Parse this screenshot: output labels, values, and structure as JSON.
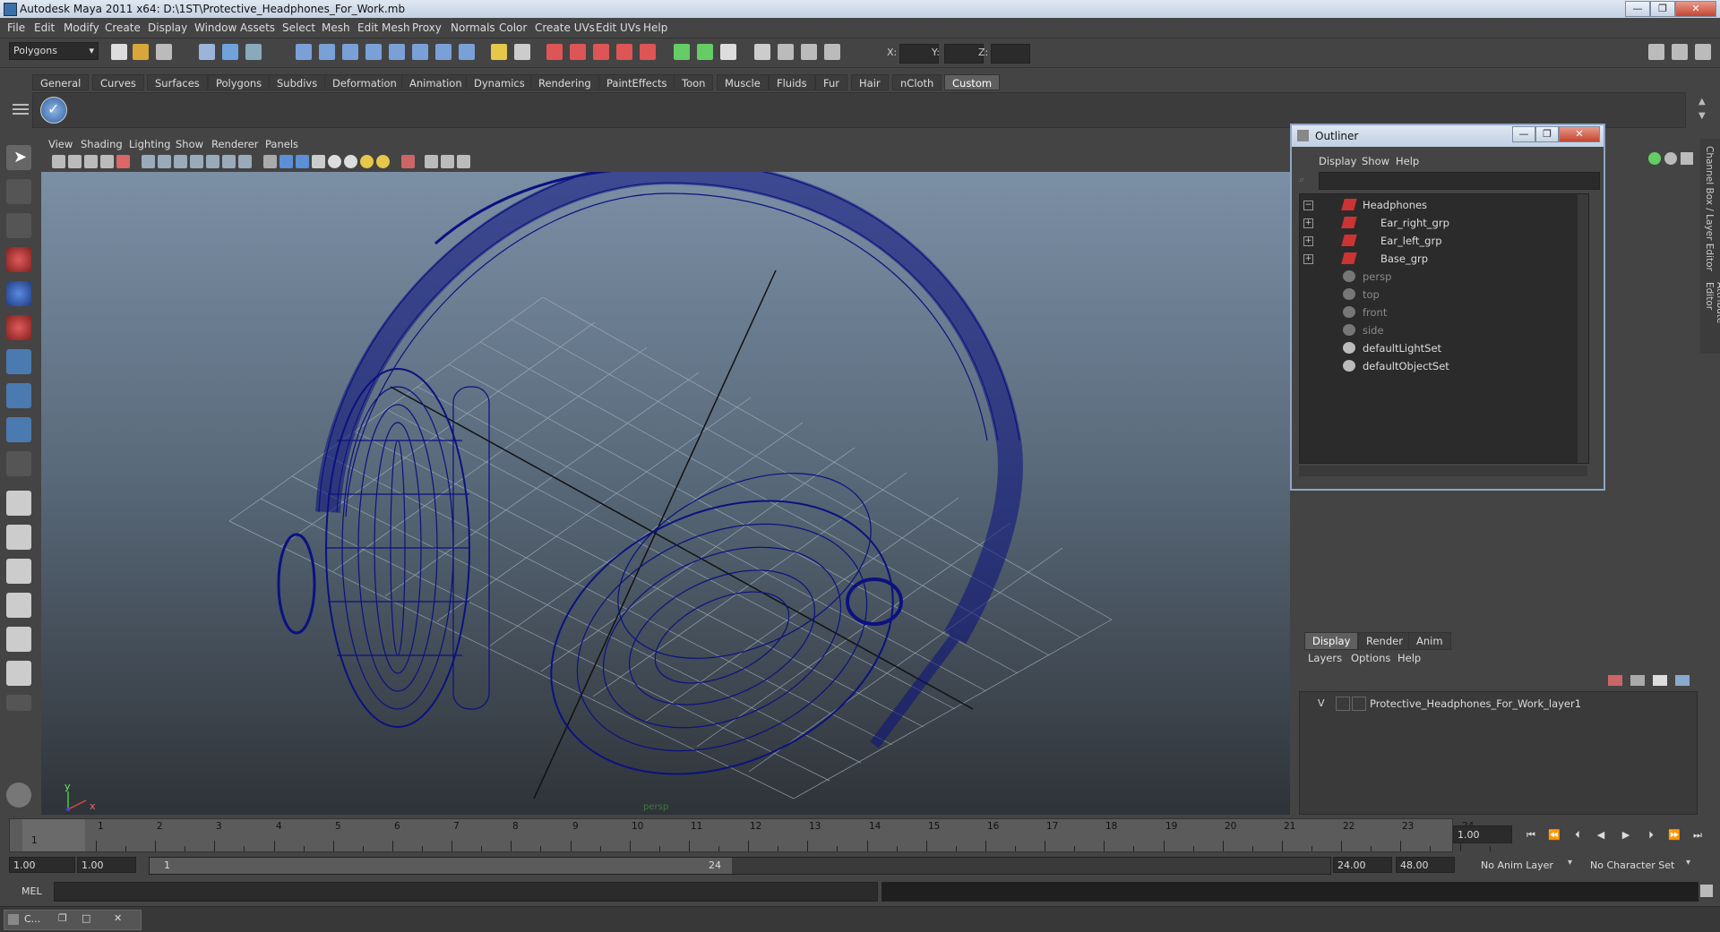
{
  "window": {
    "title": "Autodesk Maya 2011 x64: D:\\1ST\\Protective_Headphones_For_Work.mb",
    "minimize_glyph": "—",
    "maximize_glyph": "❐",
    "close_glyph": "✕"
  },
  "menubar": {
    "items": [
      "File",
      "Edit",
      "Modify",
      "Create",
      "Display",
      "Window",
      "Assets",
      "Select",
      "Mesh",
      "Edit Mesh",
      "Proxy",
      "Normals",
      "Color",
      "Create UVs",
      "Edit UVs",
      "Help"
    ]
  },
  "statusline": {
    "mode_selector": "Polygons",
    "x_label": "X:",
    "y_label": "Y:",
    "z_label": "Z:"
  },
  "shelf": {
    "tabs": [
      "General",
      "Curves",
      "Surfaces",
      "Polygons",
      "Subdivs",
      "Deformation",
      "Animation",
      "Dynamics",
      "Rendering",
      "PaintEffects",
      "Toon",
      "Muscle",
      "Fluids",
      "Fur",
      "Hair",
      "nCloth",
      "Custom"
    ],
    "active_tab": "Custom"
  },
  "viewport": {
    "menu": [
      "View",
      "Shading",
      "Lighting",
      "Show",
      "Renderer",
      "Panels"
    ],
    "axis_x": "x",
    "axis_y": "y",
    "camera_label": "persp"
  },
  "outliner": {
    "title": "Outliner",
    "menu": [
      "Display",
      "Show",
      "Help"
    ],
    "items": [
      {
        "label": "Headphones",
        "expand": "−",
        "dim": false
      },
      {
        "label": "Ear_right_grp",
        "expand": "+",
        "dim": false
      },
      {
        "label": "Ear_left_grp",
        "expand": "+",
        "dim": false
      },
      {
        "label": "Base_grp",
        "expand": "+",
        "dim": false
      },
      {
        "label": "persp",
        "dim": true
      },
      {
        "label": "top",
        "dim": true
      },
      {
        "label": "front",
        "dim": true
      },
      {
        "label": "side",
        "dim": true
      },
      {
        "label": "defaultLightSet",
        "dim": false
      },
      {
        "label": "defaultObjectSet",
        "dim": false
      }
    ]
  },
  "side_tabs": {
    "channel_box": "Channel Box / Layer Editor",
    "attribute_editor": "Attribute Editor"
  },
  "layer_editor": {
    "tabs": [
      "Display",
      "Render",
      "Anim"
    ],
    "active_tab": "Display",
    "menu": [
      "Layers",
      "Options",
      "Help"
    ],
    "layer_visibility": "V",
    "layer_name": "Protective_Headphones_For_Work_layer1"
  },
  "timeline": {
    "ticks": [
      "1",
      "2",
      "3",
      "4",
      "5",
      "6",
      "7",
      "8",
      "9",
      "10",
      "11",
      "12",
      "13",
      "14",
      "15",
      "16",
      "17",
      "18",
      "19",
      "20",
      "21",
      "22",
      "23",
      "24"
    ],
    "current_frame_marker": "1",
    "current_frame": "1.00"
  },
  "range": {
    "start_time": "1.00",
    "playback_start": "1.00",
    "range_start_label": "1",
    "range_end_label": "24",
    "playback_end": "24.00",
    "end_time": "48.00",
    "anim_layer": "No Anim Layer",
    "character_set": "No Character Set"
  },
  "commandline": {
    "label": "MEL"
  },
  "taskbar": {
    "item": "C..."
  },
  "colors": {
    "wireframe": "#0b1180",
    "grid": "#a9b6c4",
    "active_shelf": "#5f5f5f",
    "ui_bg": "#444444"
  }
}
